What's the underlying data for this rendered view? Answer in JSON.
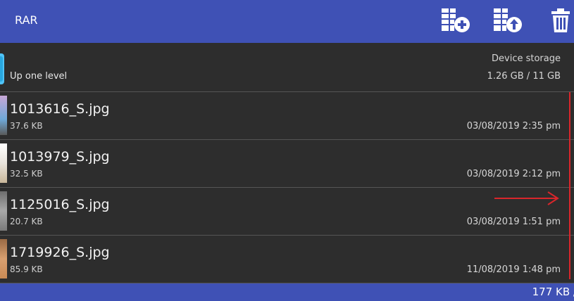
{
  "appbar": {
    "title": "RAR",
    "actions": [
      {
        "name": "add-to-archive",
        "icon": "archive-add-icon"
      },
      {
        "name": "extract-archive",
        "icon": "archive-extract-icon"
      },
      {
        "name": "delete",
        "icon": "trash-icon"
      }
    ]
  },
  "up_row": {
    "label": "Up one level",
    "storage_label": "Device storage",
    "storage_value": "1.26 GB / 11 GB"
  },
  "files": [
    {
      "name": "1013616_S.jpg",
      "size": "37.6 KB",
      "date": "03/08/2019 2:35 pm",
      "thumb_color": "#c7a7d6"
    },
    {
      "name": "1013979_S.jpg",
      "size": "32.5 KB",
      "date": "03/08/2019 2:12 pm",
      "thumb_color": "#e9e4dc"
    },
    {
      "name": "1125016_S.jpg",
      "size": "20.7 KB",
      "date": "03/08/2019 1:51 pm",
      "thumb_color": "#8f8f8f"
    },
    {
      "name": "1719926_S.jpg",
      "size": "85.9 KB",
      "date": "11/08/2019 1:48 pm",
      "thumb_color": "#c98a55"
    }
  ],
  "status": {
    "total": "177 KB /"
  },
  "colors": {
    "primary": "#3f51b5",
    "background": "#2d2d2d",
    "annotation_red": "#d9262b"
  }
}
